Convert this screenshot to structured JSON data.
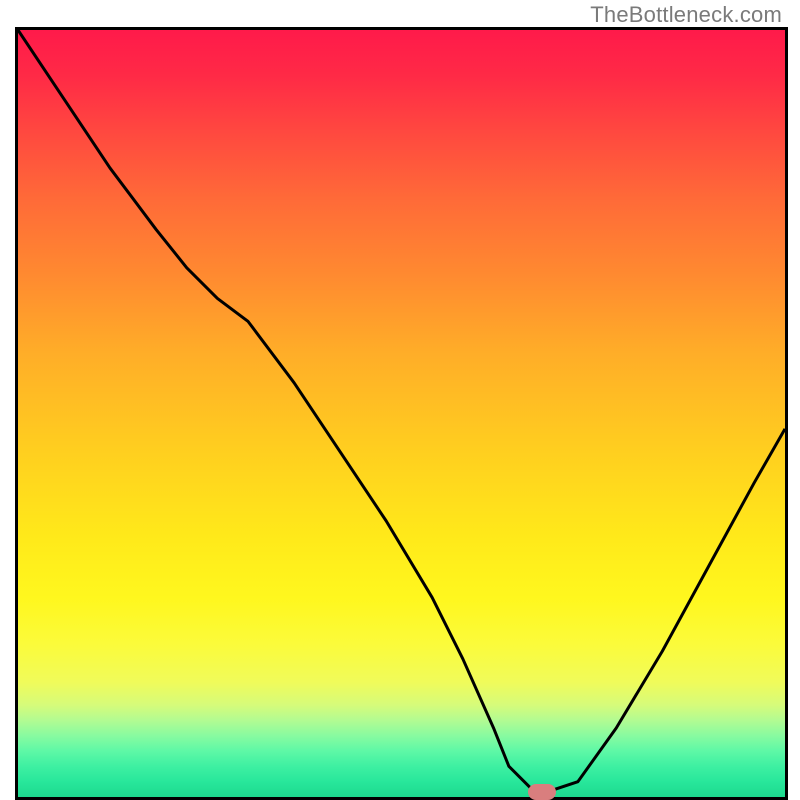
{
  "attribution": "TheBottleneck.com",
  "colors": {
    "text_muted": "#7a7a7a",
    "axis": "#000000",
    "curve": "#000000",
    "marker": "#d97e7e",
    "gradient_top": "#ff1a4a",
    "gradient_mid": "#ffe91a",
    "gradient_bottom": "#1dd98e"
  },
  "chart_data": {
    "type": "line",
    "title": "",
    "xlabel": "",
    "ylabel": "",
    "xlim": [
      0,
      100
    ],
    "ylim": [
      0,
      100
    ],
    "grid": false,
    "legend": false,
    "series": [
      {
        "name": "bottleneck-curve",
        "x": [
          0,
          6,
          12,
          18,
          22,
          26,
          30,
          36,
          42,
          48,
          54,
          58,
          62,
          64,
          67,
          70,
          73,
          78,
          84,
          90,
          96,
          100
        ],
        "y": [
          100,
          91,
          82,
          74,
          69,
          65,
          62,
          54,
          45,
          36,
          26,
          18,
          9,
          4,
          1,
          1,
          2,
          9,
          19,
          30,
          41,
          48
        ]
      }
    ],
    "annotations": [
      {
        "name": "optimal-marker",
        "x": 68,
        "y": 1,
        "shape": "rounded-rect",
        "color": "#d97e7e"
      }
    ],
    "background": {
      "type": "vertical-gradient",
      "description": "red (high) → yellow (mid) → green (low)",
      "stops": [
        {
          "pos": 0.0,
          "color": "#ff1a4a"
        },
        {
          "pos": 0.55,
          "color": "#ffcf1f"
        },
        {
          "pos": 0.8,
          "color": "#fbfb3a"
        },
        {
          "pos": 1.0,
          "color": "#1dd98e"
        }
      ]
    }
  }
}
